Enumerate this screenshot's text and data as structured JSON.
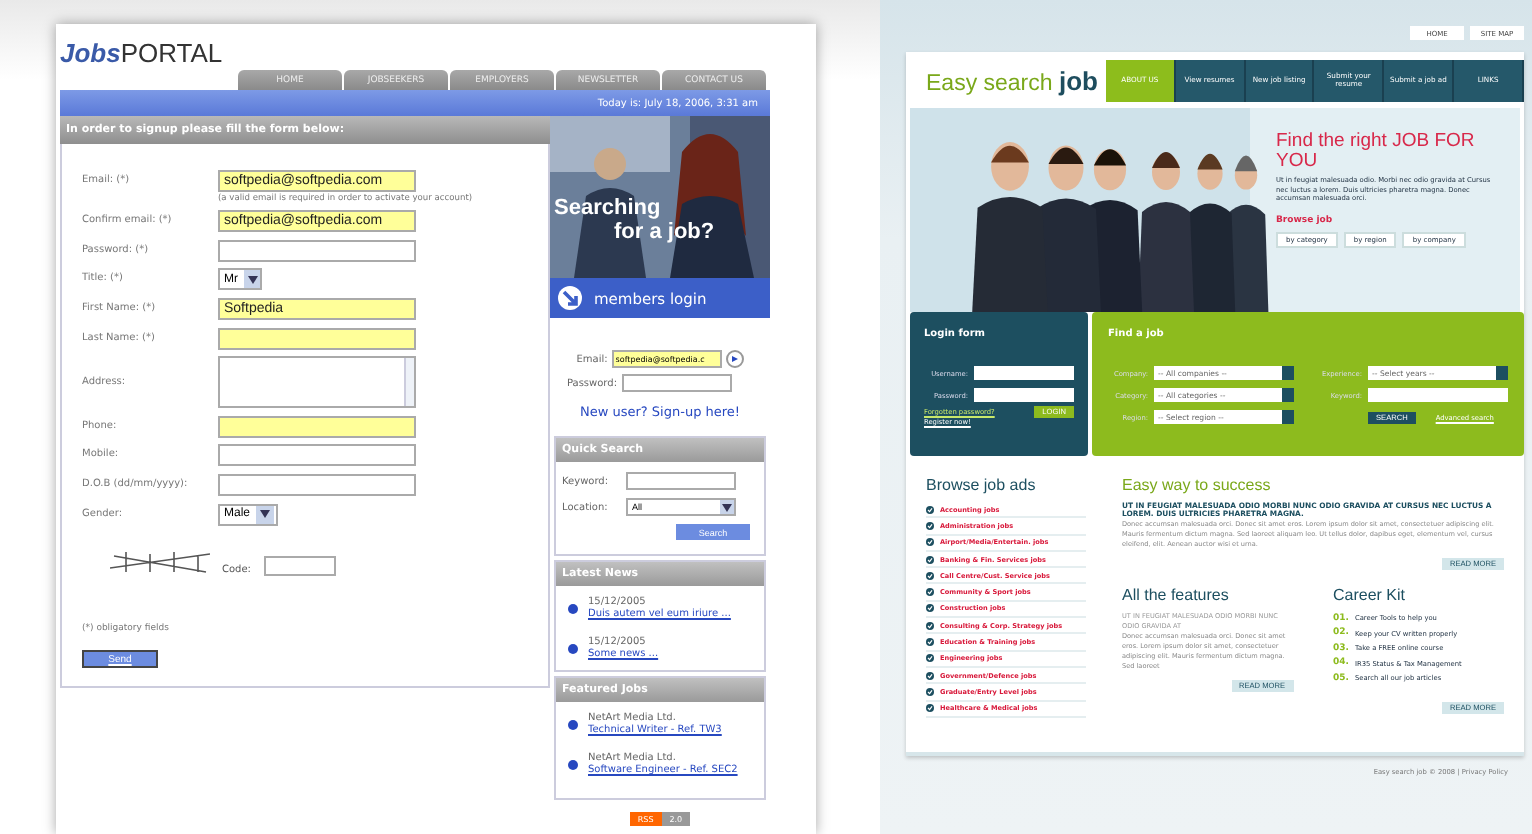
{
  "left_site": {
    "logo": {
      "italic_part": "Jobs",
      "plain_part": "PORTAL"
    },
    "nav": [
      {
        "label": "HOME"
      },
      {
        "label": "JOBSEEKERS"
      },
      {
        "label": "EMPLOYERS"
      },
      {
        "label": "NEWSLETTER"
      },
      {
        "label": "CONTACT US"
      }
    ],
    "date": "Today is: July 18, 2006, 3:31 am",
    "form_title": "In order to signup please fill the form below:",
    "fields": [
      {
        "kind": "text",
        "label": "Email: (*)",
        "value": "softpedia@softpedia.com",
        "highlighted": true
      },
      {
        "kind": "hint",
        "label": "(a valid email is required in order to activate your account)"
      },
      {
        "kind": "text",
        "label": "Confirm email: (*)",
        "value": "softpedia@softpedia.com",
        "highlighted": true
      },
      {
        "kind": "text",
        "label": "Password: (*)",
        "highlighted": false
      },
      {
        "kind": "select",
        "label": "Title: (*)",
        "value": "Mr"
      },
      {
        "kind": "text",
        "label": "First Name: (*)",
        "value": "Softpedia",
        "highlighted": true
      },
      {
        "kind": "text",
        "label": "Last Name: (*)",
        "highlighted": true
      },
      {
        "kind": "textarea",
        "label": "Address:"
      },
      {
        "kind": "text",
        "label": "Phone:",
        "highlighted": true
      },
      {
        "kind": "text",
        "label": "Mobile:",
        "highlighted": false
      },
      {
        "kind": "text",
        "label": "D.O.B (dd/mm/yyyy):",
        "highlighted": false
      },
      {
        "kind": "select",
        "label": "Gender:",
        "value": "Male"
      }
    ],
    "code_label": "Code:",
    "obligatory_note": "(*) obligatory fields",
    "send_button": "Send",
    "hero_caption": [
      "Searching",
      "for a job?"
    ],
    "members_login": {
      "title": "members login",
      "email_label": "Email:",
      "email_value": "softpedia@softpedia.c",
      "password_label": "Password:",
      "signup_link": "New user? Sign-up here!"
    },
    "quick_search": {
      "title": "Quick Search",
      "keyword_label": "Keyword:",
      "location_label": "Location:",
      "location_value": "All",
      "button": "Search"
    },
    "latest_news": {
      "title": "Latest News",
      "items": [
        {
          "date": "15/12/2005",
          "link": "Duis autem vel eum iriure ..."
        },
        {
          "date": "15/12/2005",
          "link": "Some news ..."
        }
      ]
    },
    "featured_jobs": {
      "title": "Featured Jobs",
      "items": [
        {
          "company": "NetArt Media Ltd.",
          "link": "Technical Writer - Ref. TW3"
        },
        {
          "company": "NetArt Media Ltd.",
          "link": "Software Engineer - Ref. SEC2"
        }
      ]
    },
    "feed_badge": [
      "RSS",
      "2.0"
    ]
  },
  "right_site": {
    "top_links": [
      "HOME",
      "SITE MAP"
    ],
    "logo": {
      "light_part": "Easy search",
      "bold_part": "job"
    },
    "nav": [
      {
        "label": "ABOUT US",
        "selected": true
      },
      {
        "label": "View resumes",
        "selected": false
      },
      {
        "label": "New job listing",
        "selected": false
      },
      {
        "label": "Submit your resume",
        "selected": false
      },
      {
        "label": "Submit a job ad",
        "selected": false
      },
      {
        "label": "LINKS",
        "selected": false
      }
    ],
    "hero": {
      "title": "Find the right JOB FOR YOU",
      "text": "Ut in feugiat malesuada odio. Morbi nec odio gravida at Cursus nec luctus a lorem. Duis ultricies pharetra magna. Donec accumsan malesuada orci.",
      "browse_label": "Browse job",
      "browse_buttons": [
        "by category",
        "by region",
        "by company"
      ]
    },
    "login_form": {
      "title": "Login form",
      "username_label": "Username:",
      "password_label": "Password:",
      "forgot_link": "Forgotten password?",
      "register_link": "Register now!",
      "button": "LOGIN"
    },
    "find_job": {
      "title": "Find a job",
      "selects": [
        {
          "label": "Company:",
          "value": "-- All companies --"
        },
        {
          "label": "Category:",
          "value": "-- All categories --"
        },
        {
          "label": "Region:",
          "value": "-- Select region --"
        },
        {
          "label": "Experience:",
          "value": "-- Select years --"
        }
      ],
      "keyword_label": "Keyword:",
      "button": "SEARCH",
      "advanced_link": "Advanced search"
    },
    "browse_ads": {
      "title": "Browse job ads",
      "items": [
        "Accounting jobs",
        "Administration jobs",
        "Airport/Media/Entertain. jobs",
        "Banking & Fin. Services jobs",
        "Call Centre/Cust. Service jobs",
        "Community & Sport jobs",
        "Construction jobs",
        "Consulting & Corp. Strategy jobs",
        "Education & Training jobs",
        "Engineering jobs",
        "Government/Defence jobs",
        "Graduate/Entry Level jobs",
        "Healthcare & Medical jobs"
      ]
    },
    "success": {
      "title": "Easy way to success",
      "caps": "UT IN FEUGIAT MALESUADA ODIO MORBI NUNC ODIO GRAVIDA AT CURSUS NEC LUCTUS A LOREM. DUIS ULTRICIES PHARETRA MAGNA.",
      "text": "Donec accumsan malesuada orci. Donec sit amet eros. Lorem ipsum dolor sit amet, consectetuer adipiscing elit. Mauris fermentum dictum magna. Sed laoreet aliquam leo. Ut tellus dolor, dapibus eget, elementum vel, cursus eleifend, elit. Aenean auctor wisi et urna.",
      "button": "READ MORE"
    },
    "features": {
      "title": "All the features",
      "caps": "UT IN FEUGIAT MALESUADA ODIO MORBI NUNC ODIO GRAVIDA AT",
      "text": "Donec accumsan malesuada orci. Donec sit amet eros. Lorem ipsum dolor sit amet, consectetuer adipiscing elit. Mauris fermentum dictum magna. Sed laoreet",
      "button": "READ MORE"
    },
    "career_kit": {
      "title": "Career Kit",
      "items": [
        {
          "number": "01.",
          "text": "Career Tools to help you"
        },
        {
          "number": "02.",
          "text": "Keep your CV written properly"
        },
        {
          "number": "03.",
          "text": "Take a FREE online course"
        },
        {
          "number": "04.",
          "text": "IR35 Status & Tax Management"
        },
        {
          "number": "05.",
          "text": "Search all our job articles"
        }
      ],
      "button": "READ MORE"
    },
    "footer": "Easy search job © 2008 | Privacy Policy"
  }
}
